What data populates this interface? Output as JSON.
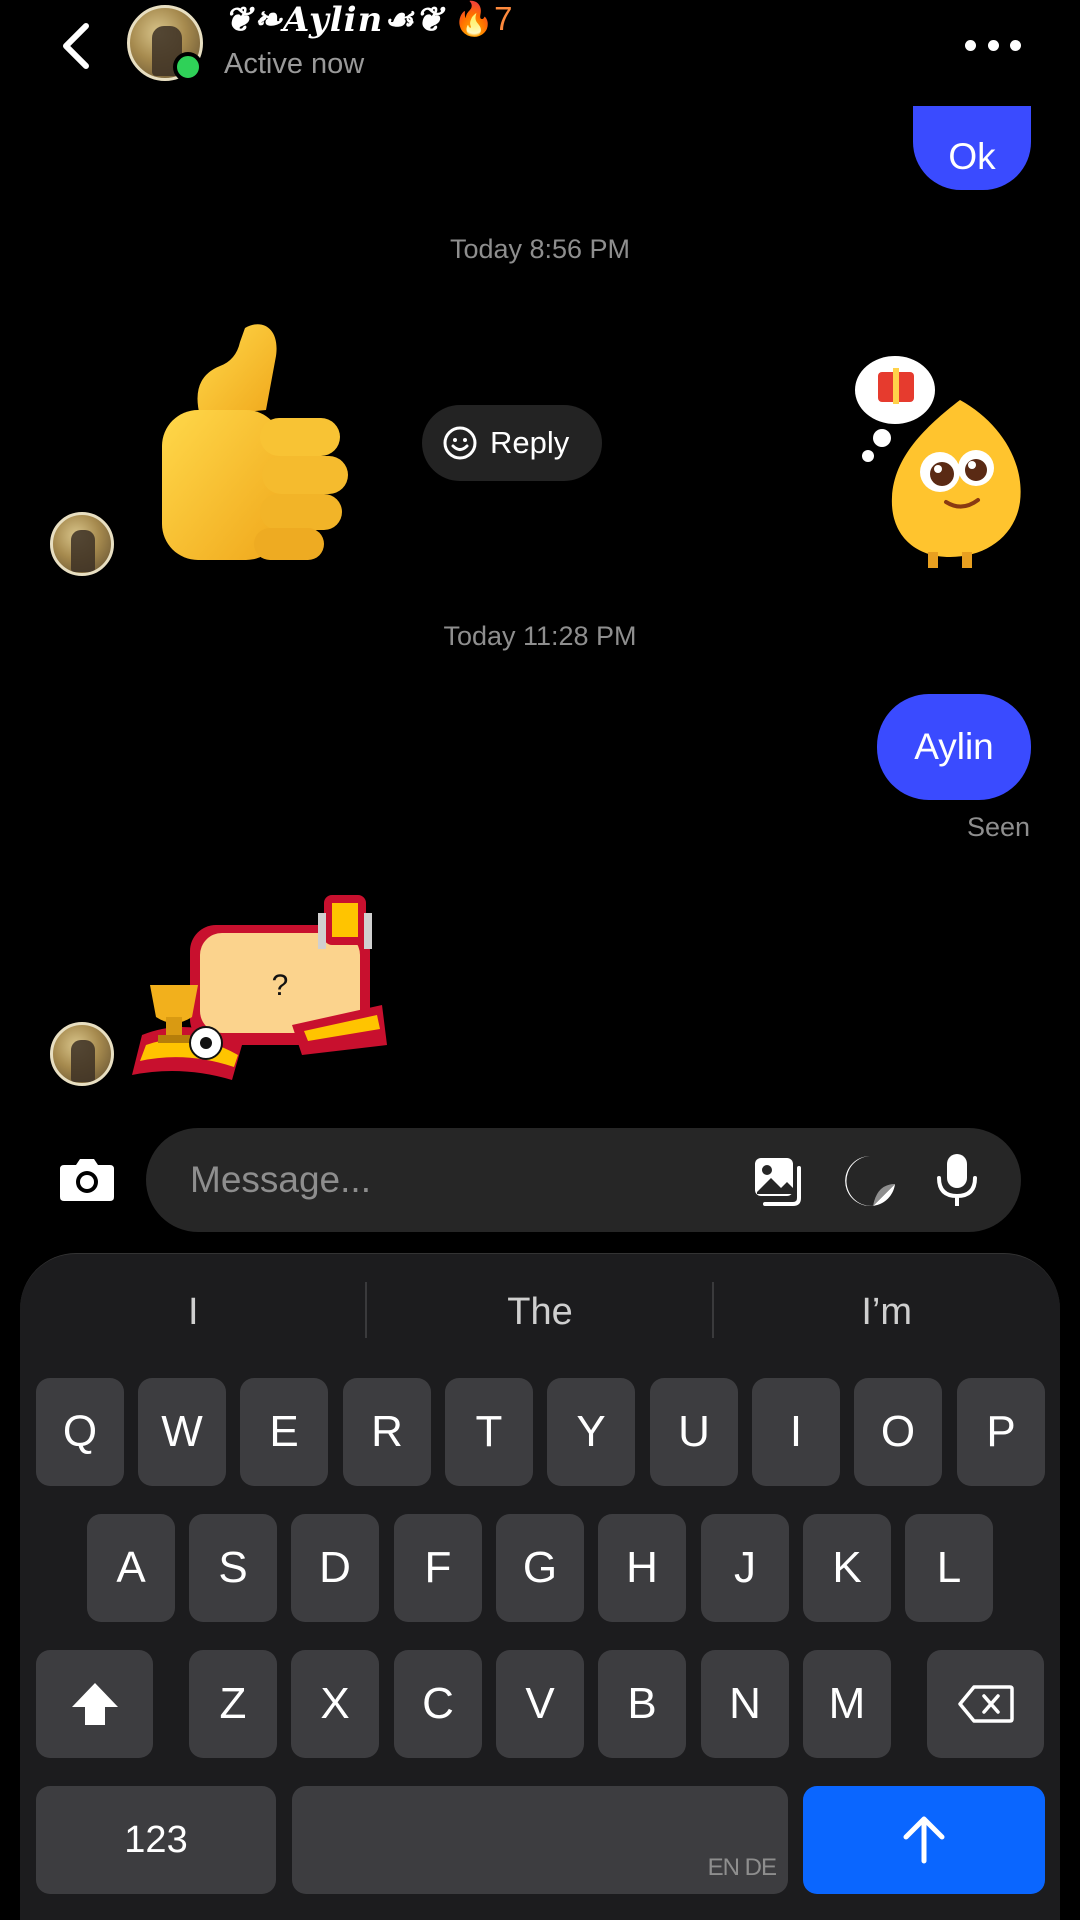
{
  "header": {
    "back_label": "Back",
    "contact_name": "❦❧Aylin☙❦",
    "streak": "🔥7",
    "status": "Active now"
  },
  "messages": {
    "ok_text": "Ok",
    "timestamp1": "Today 8:56 PM",
    "reply_label": "Reply",
    "timestamp2": "Today 11:28 PM",
    "aylin_text": "Aylin",
    "seen_text": "Seen",
    "sticker_question": "?"
  },
  "composer": {
    "placeholder": "Message..."
  },
  "keyboard": {
    "suggestions": [
      "I",
      "The",
      "I’m"
    ],
    "row1": [
      "Q",
      "W",
      "E",
      "R",
      "T",
      "Y",
      "U",
      "I",
      "O",
      "P"
    ],
    "row2": [
      "A",
      "S",
      "D",
      "F",
      "G",
      "H",
      "J",
      "K",
      "L"
    ],
    "row3": [
      "Z",
      "X",
      "C",
      "V",
      "B",
      "N",
      "M"
    ],
    "numbers_label": "123",
    "space_lang": "EN DE"
  },
  "colors": {
    "outgoing_bubble": "#3a4bff",
    "online": "#2fd158",
    "enter_key": "#0a66ff"
  }
}
